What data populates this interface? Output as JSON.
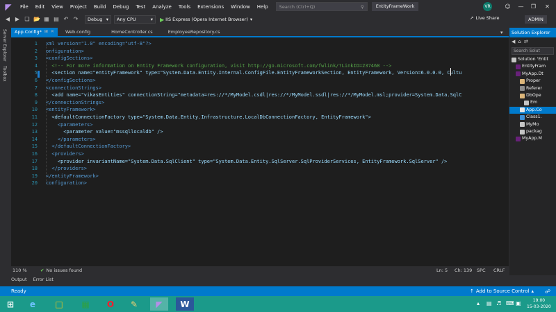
{
  "menubar": {
    "items": [
      "File",
      "Edit",
      "View",
      "Project",
      "Build",
      "Debug",
      "Test",
      "Analyze",
      "Tools",
      "Extensions",
      "Window",
      "Help"
    ],
    "search_placeholder": "Search (Ctrl+Q)",
    "solution_title": "EntityFrameWork",
    "user_initials": "VR"
  },
  "toolbar": {
    "config": "Debug",
    "platform": "Any CPU",
    "run_target": "IIS Express (Opera Internet Browser)",
    "live_share": "Live Share",
    "admin": "ADMIN"
  },
  "left_strip": {
    "server_explorer": "Server Explorer",
    "toolbox": "Toolbox"
  },
  "tabs": [
    {
      "label": "App.Config*",
      "active": true
    },
    {
      "label": "Web.config",
      "active": false
    },
    {
      "label": "HomeController.cs",
      "active": false
    },
    {
      "label": "EmployeeRepository.cs",
      "active": false
    }
  ],
  "code": [
    {
      "n": "1",
      "text": "xml version=\"1.0\" encoding=\"utf-8\"?>",
      "kind": "tag"
    },
    {
      "n": "2",
      "text": "onfiguration>",
      "kind": "tag"
    },
    {
      "n": "3",
      "text": "<configSections>",
      "kind": "tag"
    },
    {
      "n": "4",
      "text": "  <!-- For more information on Entity Framework configuration, visit http://go.microsoft.com/fwlink/?LinkID=237468 -->",
      "kind": "comment"
    },
    {
      "n": "5",
      "text": "  <section name=\"entityFramework\" type=\"System.Data.Entity.Internal.ConfigFile.EntityFrameworkSection, EntityFramework, Version=6.0.0.0, Cultu",
      "kind": "attr"
    },
    {
      "n": "6",
      "text": "</configSections>",
      "kind": "tag"
    },
    {
      "n": "7",
      "text": "<connectionStrings>",
      "kind": "tag"
    },
    {
      "n": "8",
      "text": "  <add name=\"vikasEntities\" connectionString=\"metadata=res://*/MyModel.csdl|res://*/MyModel.ssdl|res://*/MyModel.msl;provider=System.Data.SqlC",
      "kind": "attr"
    },
    {
      "n": "9",
      "text": "</connectionStrings>",
      "kind": "tag"
    },
    {
      "n": "10",
      "text": "<entityFramework>",
      "kind": "tag"
    },
    {
      "n": "11",
      "text": "  <defaultConnectionFactory type=\"System.Data.Entity.Infrastructure.LocalDbConnectionFactory, EntityFramework\">",
      "kind": "attr"
    },
    {
      "n": "12",
      "text": "    <parameters>",
      "kind": "tag"
    },
    {
      "n": "13",
      "text": "      <parameter value=\"mssqllocaldb\" />",
      "kind": "attr"
    },
    {
      "n": "14",
      "text": "    </parameters>",
      "kind": "tag"
    },
    {
      "n": "15",
      "text": "  </defaultConnectionFactory>",
      "kind": "tag"
    },
    {
      "n": "16",
      "text": "  <providers>",
      "kind": "tag"
    },
    {
      "n": "17",
      "text": "    <provider invariantName=\"System.Data.SqlClient\" type=\"System.Data.Entity.SqlServer.SqlProviderServices, EntityFramework.SqlServer\" />",
      "kind": "attr"
    },
    {
      "n": "18",
      "text": "  </providers>",
      "kind": "tag"
    },
    {
      "n": "19",
      "text": "</entityFramework>",
      "kind": "tag"
    },
    {
      "n": "20",
      "text": "configuration>",
      "kind": "tag"
    }
  ],
  "editor_status": {
    "zoom": "110 %",
    "issues": "No issues found",
    "line": "Ln: 5",
    "char": "Ch: 139",
    "spc": "SPC",
    "crlf": "CRLF"
  },
  "panel_tabs": [
    "Output",
    "Error List"
  ],
  "statusbar": {
    "ready": "Ready",
    "add_source": "Add to Source Control"
  },
  "solution_explorer": {
    "title": "Solution Explorer",
    "search_placeholder": "Search Solut",
    "items": [
      {
        "label": "Solution 'Entit",
        "depth": 0,
        "selected": false,
        "color": "#c5c5c5"
      },
      {
        "label": "EntityFram",
        "depth": 1,
        "selected": false,
        "color": "#68217a"
      },
      {
        "label": "MyApp.Dt",
        "depth": 1,
        "selected": false,
        "color": "#68217a"
      },
      {
        "label": "Proper",
        "depth": 2,
        "selected": false,
        "color": "#dcb67a"
      },
      {
        "label": "Referer",
        "depth": 2,
        "selected": false,
        "color": "#8c8c8c"
      },
      {
        "label": "DbOpe",
        "depth": 2,
        "selected": false,
        "color": "#dcb67a"
      },
      {
        "label": "Em",
        "depth": 3,
        "selected": false,
        "color": "#c5c5c5"
      },
      {
        "label": "App.Co",
        "depth": 2,
        "selected": true,
        "color": "#e8e8e8"
      },
      {
        "label": "Class1.",
        "depth": 2,
        "selected": false,
        "color": "#3c8fd6"
      },
      {
        "label": "MyMo",
        "depth": 2,
        "selected": false,
        "color": "#c5c5c5"
      },
      {
        "label": "packag",
        "depth": 2,
        "selected": false,
        "color": "#c5c5c5"
      },
      {
        "label": "MyApp.M",
        "depth": 1,
        "selected": false,
        "color": "#68217a"
      }
    ]
  },
  "taskbar": {
    "time": "19:00",
    "date": "15-03-2020"
  }
}
